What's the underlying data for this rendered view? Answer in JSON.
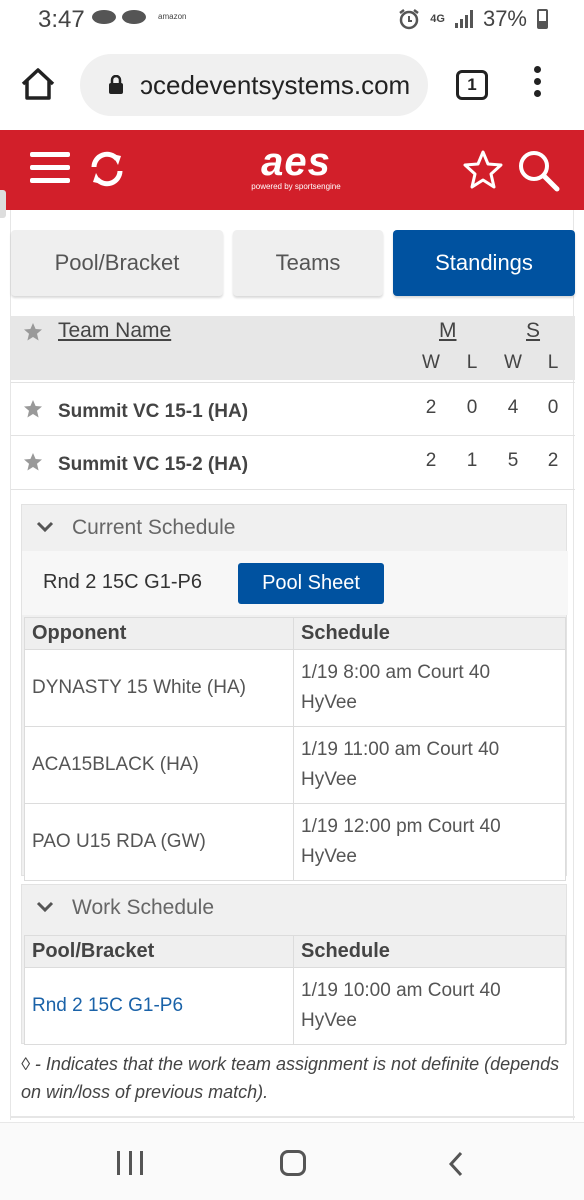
{
  "status_bar": {
    "time": "3:47",
    "amazon_label": "amazon",
    "network": "4G",
    "battery": "37%"
  },
  "browser": {
    "url": "ɔcedeventsystems.com",
    "tab_count": "1"
  },
  "header": {
    "logo": "aes",
    "logo_sub": "powered by sportsengine"
  },
  "tabs": [
    {
      "label": "Pool/Bracket",
      "active": false
    },
    {
      "label": "Teams",
      "active": false
    },
    {
      "label": "Standings",
      "active": true
    }
  ],
  "standings": {
    "columns": {
      "team": "Team Name",
      "m": "M",
      "s": "S",
      "w": "W",
      "l": "L"
    },
    "rows": [
      {
        "team": "Summit VC 15-1 (HA)",
        "mw": "2",
        "ml": "0",
        "sw": "4",
        "sl": "0"
      },
      {
        "team": "Summit VC 15-2 (HA)",
        "mw": "2",
        "ml": "1",
        "sw": "5",
        "sl": "2"
      }
    ]
  },
  "current_schedule": {
    "title": "Current Schedule",
    "pool_label": "Rnd 2 15C G1-P6",
    "pool_button": "Pool Sheet",
    "headers": {
      "opponent": "Opponent",
      "schedule": "Schedule"
    },
    "rows": [
      {
        "opponent": "DYNASTY 15 White (HA)",
        "line1": "1/19 8:00 am Court 40",
        "line2": "HyVee"
      },
      {
        "opponent": "ACA15BLACK (HA)",
        "line1": "1/19 11:00 am Court 40",
        "line2": "HyVee"
      },
      {
        "opponent": "PAO U15 RDA (GW)",
        "line1": "1/19 12:00 pm Court 40",
        "line2": "HyVee"
      }
    ]
  },
  "work_schedule": {
    "title": "Work Schedule",
    "headers": {
      "pool": "Pool/Bracket",
      "schedule": "Schedule"
    },
    "rows": [
      {
        "pool": "Rnd 2 15C G1-P6",
        "line1": "1/19 10:00 am Court 40",
        "line2": "HyVee"
      }
    ]
  },
  "note": "◊ - Indicates that the work team assignment is not definite (depends on win/loss of previous match).",
  "colors": {
    "brand_red": "#d21f2a",
    "active_blue": "#0052a0",
    "link_blue": "#1a62a8"
  }
}
